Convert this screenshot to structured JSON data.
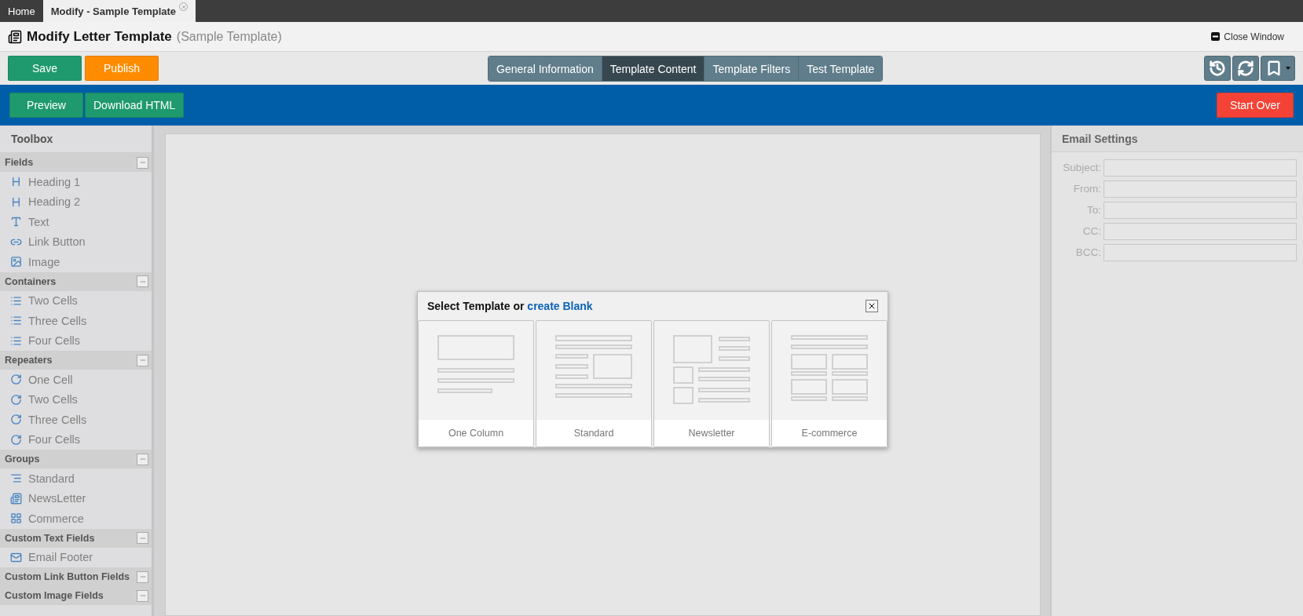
{
  "doc_tabs": [
    {
      "label": "Home",
      "selected": false,
      "closable": false
    },
    {
      "label": "Modify - Sample Template",
      "selected": true,
      "closable": true
    }
  ],
  "header": {
    "title": "Modify Letter Template",
    "subtitle": "(Sample Template)",
    "close_label": "Close Window"
  },
  "actions": [
    {
      "label": "Save",
      "kind": "green"
    },
    {
      "label": "Publish",
      "kind": "orange"
    }
  ],
  "steps": [
    {
      "label": "General Information",
      "selected": false
    },
    {
      "label": "Template Content",
      "selected": true
    },
    {
      "label": "Template Filters",
      "selected": false
    },
    {
      "label": "Test Template",
      "selected": false
    }
  ],
  "subactions": [
    {
      "label": "Preview",
      "kind": "green"
    },
    {
      "label": "Download HTML",
      "kind": "green"
    }
  ],
  "start_over": "Start Over",
  "toolbox": {
    "title": "Toolbox",
    "groups": [
      {
        "label": "Fields",
        "expanded": true,
        "items": [
          {
            "label": "Heading 1",
            "kind": "heading"
          },
          {
            "label": "Heading 2",
            "kind": "heading"
          },
          {
            "label": "Text",
            "kind": "text"
          },
          {
            "label": "Link Button",
            "kind": "link"
          },
          {
            "label": "Image",
            "kind": "image"
          }
        ]
      },
      {
        "label": "Containers",
        "expanded": true,
        "items": [
          {
            "label": "Two Cells",
            "kind": "cells"
          },
          {
            "label": "Three Cells",
            "kind": "cells"
          },
          {
            "label": "Four Cells",
            "kind": "cells"
          }
        ]
      },
      {
        "label": "Repeaters",
        "expanded": true,
        "items": [
          {
            "label": "One Cell",
            "kind": "repeat"
          },
          {
            "label": "Two Cells",
            "kind": "repeat"
          },
          {
            "label": "Three Cells",
            "kind": "repeat"
          },
          {
            "label": "Four Cells",
            "kind": "repeat"
          }
        ]
      },
      {
        "label": "Groups",
        "expanded": true,
        "items": [
          {
            "label": "Standard",
            "kind": "lines"
          },
          {
            "label": "NewsLetter",
            "kind": "newspaper"
          },
          {
            "label": "Commerce",
            "kind": "grid"
          }
        ]
      },
      {
        "label": "Custom Text Fields",
        "expanded": true,
        "items": [
          {
            "label": "Email Footer",
            "kind": "mail"
          }
        ]
      },
      {
        "label": "Custom Link Button Fields",
        "expanded": true
      },
      {
        "label": "Custom Image Fields",
        "expanded": true
      }
    ]
  },
  "dialog": {
    "title": "Select Template or",
    "link": "create Blank",
    "templates": [
      {
        "label": "One Column",
        "kind": "one_column"
      },
      {
        "label": "Standard",
        "kind": "standard"
      },
      {
        "label": "Newsletter",
        "kind": "newsletter"
      },
      {
        "label": "E-commerce",
        "kind": "ecommerce"
      }
    ]
  },
  "email_settings": {
    "title": "Email Settings",
    "fields": [
      {
        "label": "Subject:"
      },
      {
        "label": "From:"
      },
      {
        "label": "To:"
      },
      {
        "label": "CC:"
      },
      {
        "label": "BCC:"
      }
    ]
  }
}
